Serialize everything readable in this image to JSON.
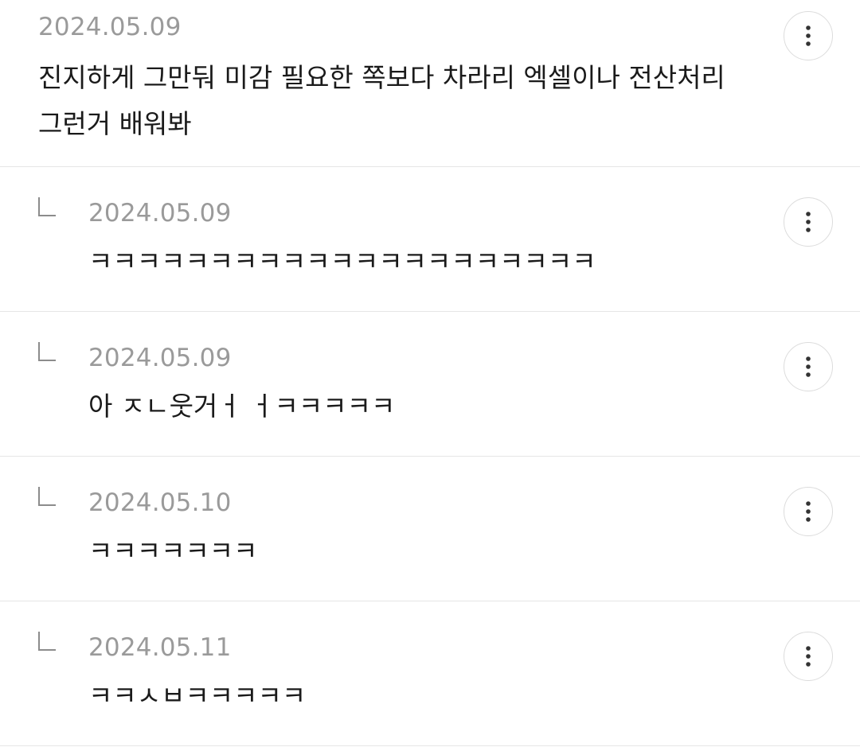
{
  "comments": [
    {
      "date": "2024.05.09",
      "text": "진지하게 그만둬 미감 필요한 쪽보다 차라리 엑셀이나 전산처리\n그런거 배워봐",
      "is_reply": false
    },
    {
      "date": "2024.05.09",
      "text": "ㅋㅋㅋㅋㅋㅋㅋㅋㅋㅋㅋㅋㅋㅋㅋㅋㅋㅋㅋㅋㅋ",
      "is_reply": true
    },
    {
      "date": "2024.05.09",
      "text": "아 ㅈㄴ웃거ㅓ ㅓㅋㅋㅋㅋㅋ",
      "is_reply": true
    },
    {
      "date": "2024.05.10",
      "text": "ㅋㅋㅋㅋㅋㅋㅋ",
      "is_reply": true
    },
    {
      "date": "2024.05.11",
      "text": "ㅋㅋㅅㅂㅋㅋㅋㅋㅋ",
      "is_reply": true
    }
  ],
  "icons": {
    "more": "more-vertical-icon",
    "reply": "reply-arrow-icon"
  }
}
